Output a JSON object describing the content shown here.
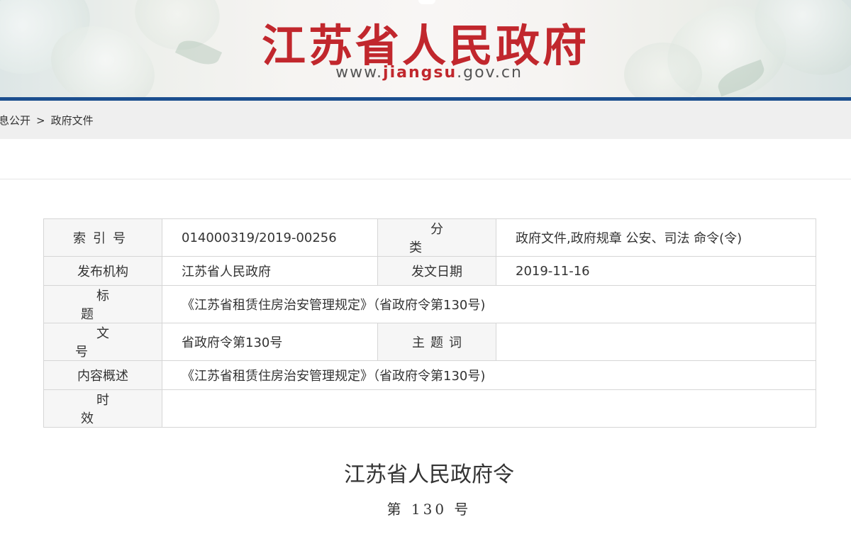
{
  "header": {
    "site_title": "江苏省人民政府",
    "url_prefix": "www.",
    "url_highlight": "jiangsu",
    "url_suffix": ".gov.cn",
    "colors": {
      "title_red": "#c1272d",
      "bar_blue": "#1c4f8f"
    }
  },
  "breadcrumb": {
    "items": [
      "息公开",
      "政府文件"
    ],
    "separator": ">"
  },
  "info_table": {
    "index_label": "索引号",
    "index_value": "014000319/2019-00256",
    "category_label": "分类",
    "category_value": "政府文件,政府规章 公安、司法 命令(令)",
    "publisher_label": "发布机构",
    "publisher_value": "江苏省人民政府",
    "date_label": "发文日期",
    "date_value": "2019-11-16",
    "title_label": "标题",
    "title_value": "《江苏省租赁住房治安管理规定》（省政府令第130号)",
    "doc_no_label": "文号",
    "doc_no_value": "省政府令第130号",
    "keywords_label": "主题词",
    "keywords_value": "",
    "summary_label": "内容概述",
    "summary_value": "《江苏省租赁住房治安管理规定》（省政府令第130号)",
    "validity_label": "时效",
    "validity_value": ""
  },
  "document": {
    "title": "江苏省人民政府令",
    "number": "第 130 号"
  }
}
